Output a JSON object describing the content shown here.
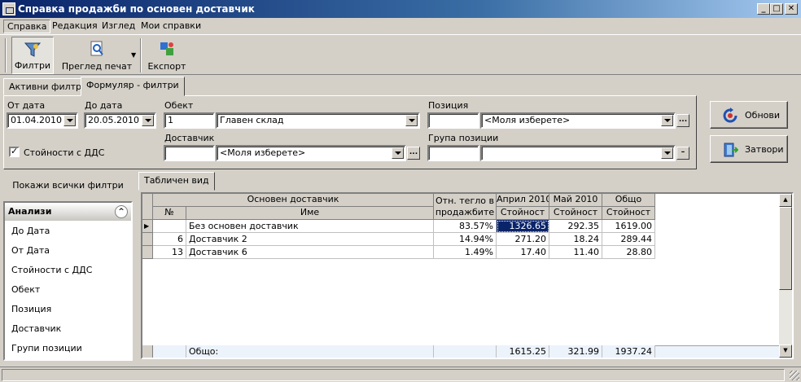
{
  "window": {
    "title": "Справка продажби по основен доставчик",
    "min": "_",
    "max": "□",
    "close": "✕"
  },
  "menu": [
    "Справка",
    "Редакция",
    "Изглед",
    "Мои справки"
  ],
  "toolbar": {
    "filters": "Филтри",
    "print_preview": "Преглед печат",
    "export": "Експорт"
  },
  "tabs": {
    "active_filters": "Активни филтри",
    "form_filters": "Формуляр - филтри"
  },
  "filters": {
    "from_date_label": "От дата",
    "from_date": "01.04.2010",
    "to_date_label": "До дата",
    "to_date": "20.05.2010",
    "object_label": "Обект",
    "object_code": "1",
    "object_name": "Главен склад",
    "position_label": "Позиция",
    "position_code": "",
    "position_name": "<Моля изберете>",
    "vat_label": "Стойности с ДДС",
    "vat_checked": true,
    "supplier_label": "Доставчик",
    "supplier_code": "",
    "supplier_name": "<Моля изберете>",
    "group_label": "Група позиции",
    "group_code": "",
    "group_name": "",
    "ellipsis": "...",
    "minus": "–"
  },
  "buttons": {
    "refresh": "Обнови",
    "close": "Затвори"
  },
  "left": {
    "show_all": "Покажи всички филтри",
    "header": "Анализи",
    "collapse": "^",
    "items": [
      "До Дата",
      "От Дата",
      "Стойности с ДДС",
      "Обект",
      "Позиция",
      "Доставчик",
      "Групи позиции"
    ]
  },
  "grid_tab": "Табличен вид",
  "grid": {
    "group_header": "Основен доставчик",
    "col_no": "№",
    "col_name": "Име",
    "col_share": "Отн. тегло в продажбите",
    "months": [
      "Април 2010",
      "Май 2010",
      "Общо"
    ],
    "sub": "Стойност",
    "rows": [
      {
        "no": "",
        "name": "Без основен доставчик",
        "share": "83.57%",
        "apr": "1326.65",
        "may": "292.35",
        "total": "1619.00"
      },
      {
        "no": "6",
        "name": "Доставчик 2",
        "share": "14.94%",
        "apr": "271.20",
        "may": "18.24",
        "total": "289.44"
      },
      {
        "no": "13",
        "name": "Доставчик 6",
        "share": "1.49%",
        "apr": "17.40",
        "may": "11.40",
        "total": "28.80"
      }
    ],
    "footer": {
      "label": "Общо:",
      "apr": "1615.25",
      "may": "321.99",
      "total": "1937.24"
    }
  },
  "scroll": {
    "up": "▲",
    "down": "▼"
  },
  "indicator": "▶"
}
